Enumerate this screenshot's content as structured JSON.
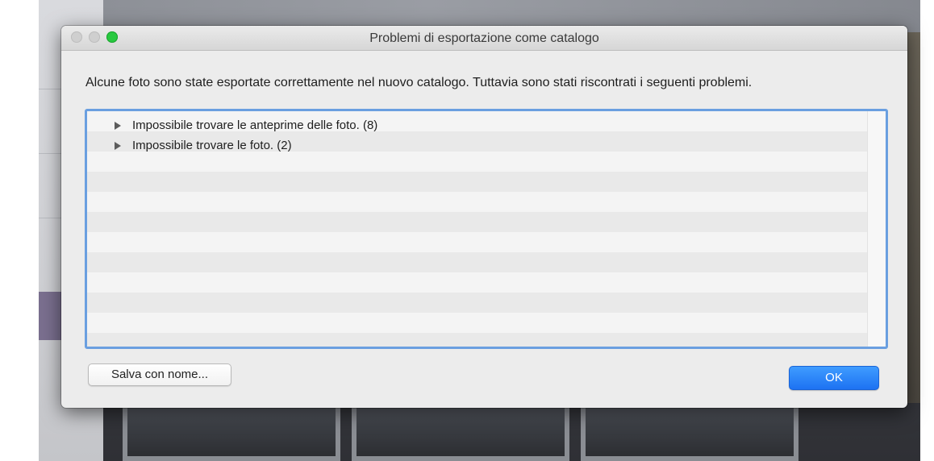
{
  "window": {
    "title": "Problemi di esportazione come catalogo"
  },
  "message": "Alcune foto sono state esportate correttamente nel nuovo catalogo. Tuttavia sono stati riscontrati i seguenti problemi.",
  "problems": [
    {
      "label": "Impossibile trovare le anteprime delle foto. (8)",
      "icon": "disclosure-triangle-right"
    },
    {
      "label": "Impossibile trovare le foto. (2)",
      "icon": "disclosure-triangle-right"
    }
  ],
  "buttons": {
    "save_as": "Salva con nome...",
    "ok": "OK"
  },
  "colors": {
    "default_button": "#1d72f2",
    "focus_ring": "#6a9fe0",
    "zoom_light": "#28c940"
  }
}
